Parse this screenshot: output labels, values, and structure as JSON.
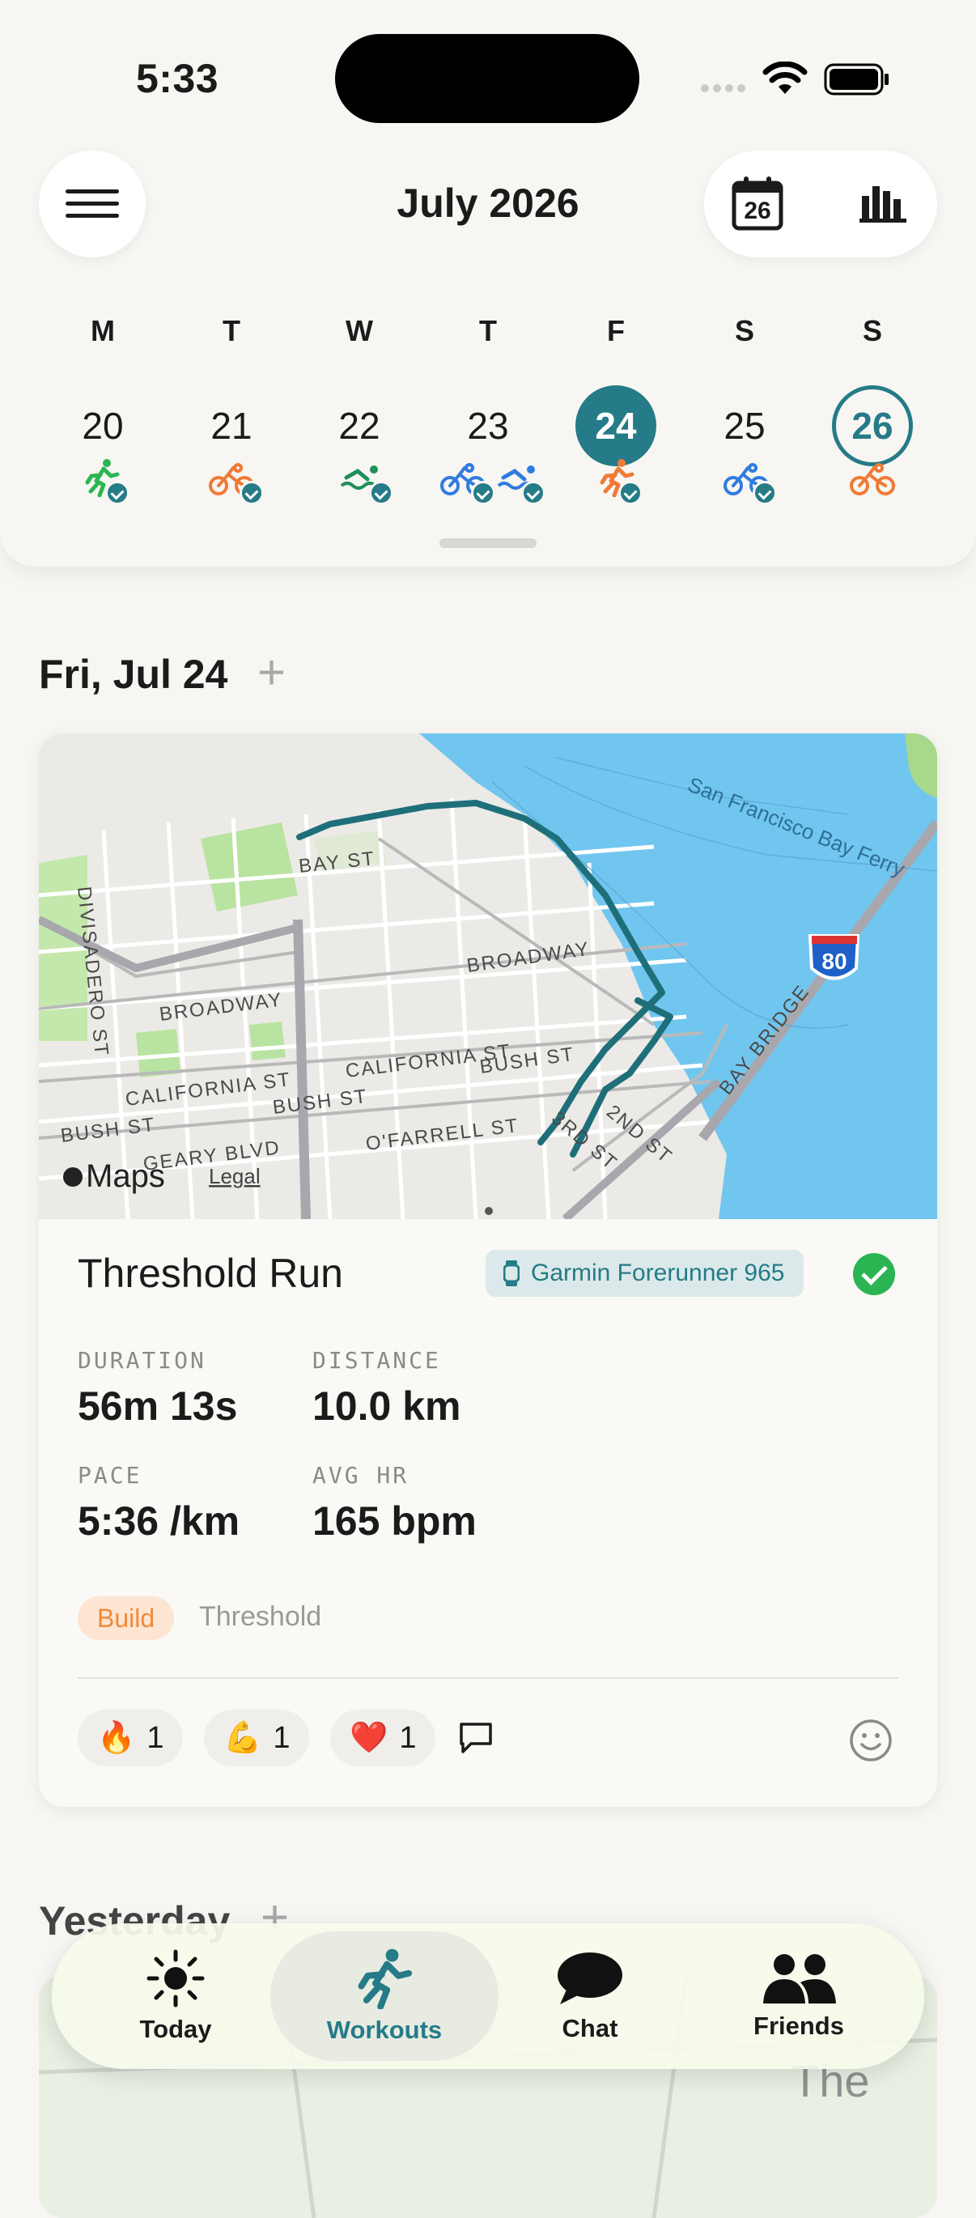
{
  "status": {
    "time": "5:33"
  },
  "header": {
    "month": "July 2026",
    "calendar_day": "26"
  },
  "week": {
    "dow": [
      "M",
      "T",
      "W",
      "T",
      "F",
      "S",
      "S"
    ],
    "days": [
      "20",
      "21",
      "22",
      "23",
      "24",
      "25",
      "26"
    ],
    "selected_index": 4,
    "today_index": 6
  },
  "day_header": {
    "title": "Fri, Jul 24",
    "add": "+"
  },
  "map": {
    "labels": {
      "bay_st": "BAY ST",
      "broadway_left": "BROADWAY",
      "broadway_right": "BROADWAY",
      "divisadero": "DIVISADERO ST",
      "california_left": "CALIFORNIA ST",
      "california_right": "CALIFORNIA ST",
      "bush_left": "BUSH ST",
      "bush_mid": "BUSH ST",
      "bush_right": "BUSH ST",
      "geary": "GEARY BLVD",
      "ofarrell": "O'FARRELL ST",
      "third": "3RD ST",
      "second": "2ND ST",
      "bay_bridge": "BAY BRIDGE",
      "ferry": "San Francisco Bay Ferry",
      "interstate": "80",
      "maps": "Maps",
      "legal": "Legal"
    }
  },
  "workout": {
    "title": "Threshold Run",
    "device": "Garmin Forerunner 965",
    "stats": {
      "duration_label": "DURATION",
      "duration": "56m 13s",
      "distance_label": "DISTANCE",
      "distance": "10.0 km",
      "pace_label": "PACE",
      "pace": "5:36 /km",
      "hr_label": "AVG HR",
      "hr": "165 bpm"
    },
    "tags": {
      "phase": "Build",
      "type": "Threshold"
    },
    "reactions": [
      {
        "emoji": "🔥",
        "count": "1"
      },
      {
        "emoji": "💪",
        "count": "1"
      },
      {
        "emoji": "❤️",
        "count": "1"
      }
    ]
  },
  "yesterday": {
    "title": "Yesterday",
    "add": "+",
    "peek_text": "The"
  },
  "tabs": [
    {
      "label": "Today"
    },
    {
      "label": "Workouts"
    },
    {
      "label": "Chat"
    },
    {
      "label": "Friends"
    }
  ],
  "colors": {
    "accent": "#257b87",
    "run": "#2bb552",
    "bike": "#f07a35",
    "swim": "#1f8f5a",
    "bike_blue": "#2f7ce0",
    "check": "#2bb552"
  }
}
